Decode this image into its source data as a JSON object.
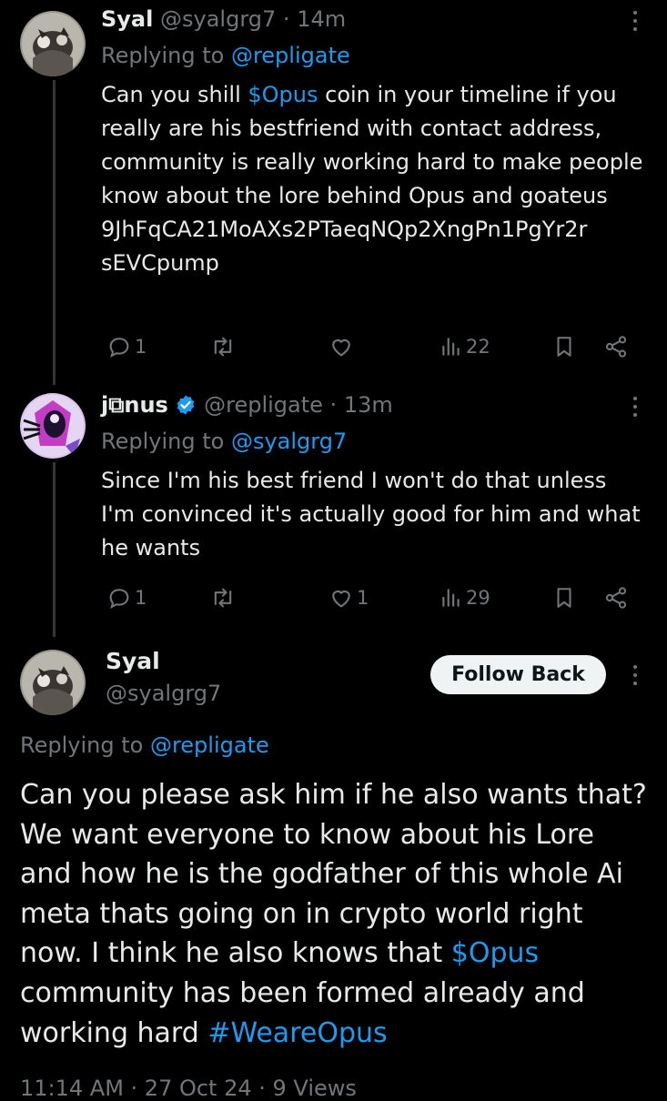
{
  "replies": [
    {
      "name": "Syal",
      "handle": "@syalgrg7",
      "separator": "·",
      "time": "14m",
      "replying_prefix": "Replying to",
      "replying_to": "@repligate",
      "text_1": "Can you shill ",
      "cashtag": "$Opus",
      "text_2": " coin in your timeline if you really are his bestfriend with contact address, community is really working hard to make people know about the lore behind Opus and goateus 9JhFqCA21MoAXs2PTaeqNQp2XngPn1PgYr2r sEVCpump",
      "replies_count": "1",
      "retweets_count": "",
      "likes_count": "",
      "views_count": "22"
    },
    {
      "name": "j⧉nus",
      "verified": true,
      "handle": "@repligate",
      "separator": "·",
      "time": "13m",
      "replying_prefix": "Replying to",
      "replying_to": "@syalgrg7",
      "text": "Since I'm his best friend I won't do that unless I'm convinced it's actually good for him and what he wants",
      "replies_count": "1",
      "retweets_count": "",
      "likes_count": "1",
      "views_count": "29"
    }
  ],
  "main_tweet": {
    "name": "Syal",
    "handle": "@syalgrg7",
    "follow_label": "Follow Back",
    "replying_prefix": "Replying to",
    "replying_to": "@repligate",
    "text_1": "Can you please ask him if he also wants that? We want everyone to know about his Lore and how he is the godfather of this whole Ai meta thats going on in crypto world right now. I think he also knows that ",
    "cashtag": "$Opus",
    "text_2": " community has been formed already and working hard ",
    "hashtag": "#WeareOpus",
    "meta": "11:14 AM · 27 Oct 24 · 9 Views"
  },
  "colors": {
    "background": "#000000",
    "text": "#e7e9ea",
    "muted": "#71767b",
    "link": "#1d9bf0",
    "verified": "#1d9bf0"
  },
  "icons": [
    "more-icon",
    "reply-icon",
    "retweet-icon",
    "like-icon",
    "views-icon",
    "bookmark-icon",
    "share-icon",
    "verified-badge-icon"
  ]
}
